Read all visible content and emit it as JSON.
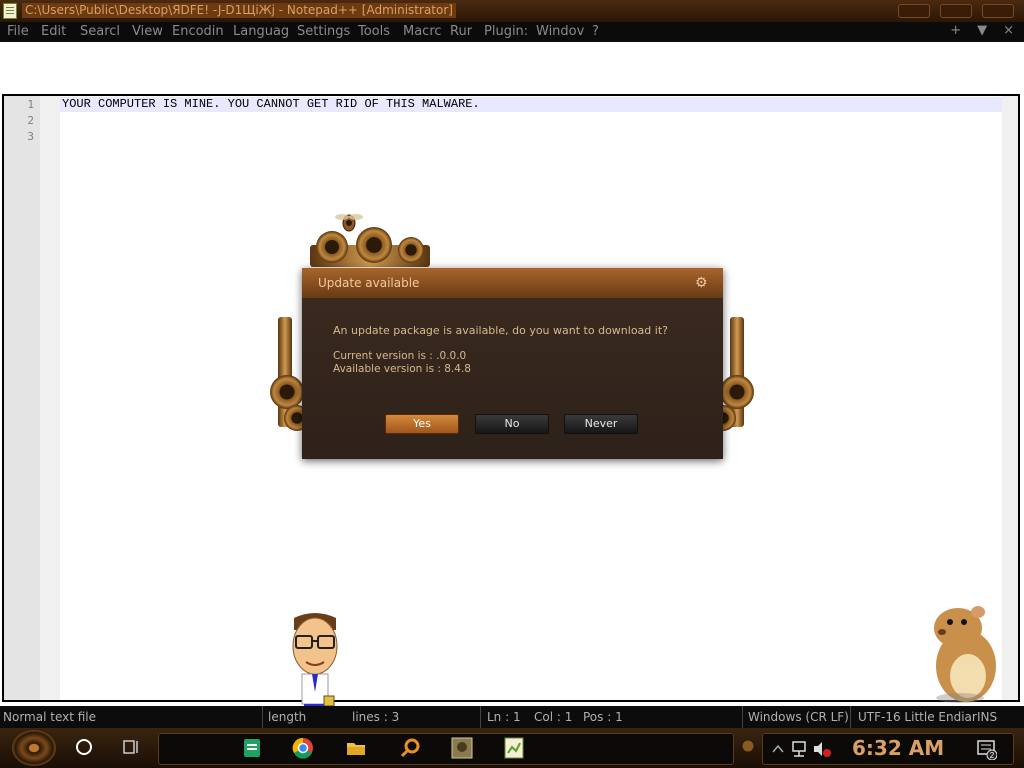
{
  "window": {
    "title": "C:\\Users\\Public\\Desktop\\ЯDFE!  -J-D1ЩiЖj  - Notepad++ [Administrator]"
  },
  "menu": {
    "items": [
      "File",
      "Edit",
      "Searcl",
      "View",
      "Encodin",
      "Languag",
      "Settings",
      "Tools",
      "Macrc",
      "Rur",
      "Plugin:",
      "Windov",
      "?"
    ],
    "right": [
      "+",
      "▼",
      "×"
    ]
  },
  "editor": {
    "line_numbers": [
      "1",
      "2",
      "3"
    ],
    "lines": [
      "YOUR COMPUTER IS MINE. YOU CANNOT GET RID OF THIS MALWARE.",
      "",
      ""
    ]
  },
  "dialog": {
    "title": "Update available",
    "message": "An update package is available, do you want to download it?",
    "current_version": "Current version is   : .0.0.0",
    "available_version": "Available version is : 8.4.8",
    "buttons": {
      "yes": "Yes",
      "no": "No",
      "never": "Never"
    }
  },
  "statusbar": {
    "file_type": "Normal text file",
    "length": "length",
    "lines": "lines : 3",
    "ln": "Ln : 1",
    "col": "Col : 1",
    "pos": "Pos : 1",
    "eol": "Windows (CR LF)",
    "encoding": "UTF-16 Little Endiar",
    "mode": "INS"
  },
  "taskbar": {
    "clock": "6:32 AM",
    "notification_count": "2",
    "apps": [
      "sheets-icon",
      "chrome-icon",
      "folder-icon",
      "search-app-icon",
      "game-icon",
      "notepadpp-icon"
    ]
  },
  "colors": {
    "accent": "#a0561c",
    "titlebar": "#2b1606",
    "dialog_bg": "#2d2119"
  }
}
